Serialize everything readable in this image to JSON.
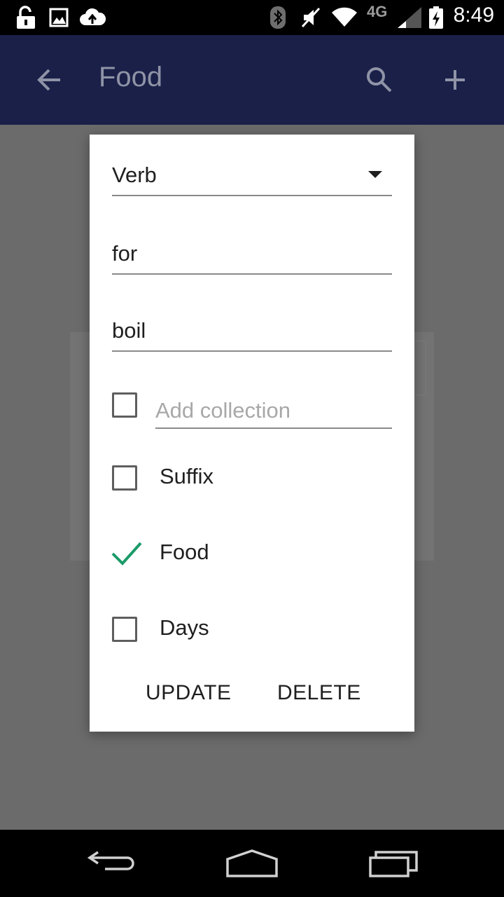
{
  "status_bar": {
    "time": "8:49",
    "network": "4G",
    "icons": [
      "lock-open-icon",
      "image-icon",
      "cloud-upload-icon",
      "bluetooth-icon",
      "mute-icon",
      "wifi-icon",
      "cell-signal-icon",
      "battery-icon"
    ]
  },
  "app_bar": {
    "title": "Food",
    "icons": [
      "back-arrow-icon",
      "search-icon",
      "add-icon"
    ]
  },
  "dialog": {
    "word_type": {
      "selected": "Verb"
    },
    "foreign_field": {
      "value": "for"
    },
    "native_field": {
      "value": "boil"
    },
    "add_collection": {
      "placeholder": "Add collection",
      "checked": false
    },
    "collections": [
      {
        "label": "Suffix",
        "checked": false
      },
      {
        "label": "Food",
        "checked": true
      },
      {
        "label": "Days",
        "checked": false
      }
    ],
    "buttons": {
      "update": "UPDATE",
      "delete": "DELETE"
    }
  },
  "colors": {
    "app_bar": "#1a2048",
    "check_accent": "#1a9b68",
    "scrim": "#6b6b6b"
  }
}
